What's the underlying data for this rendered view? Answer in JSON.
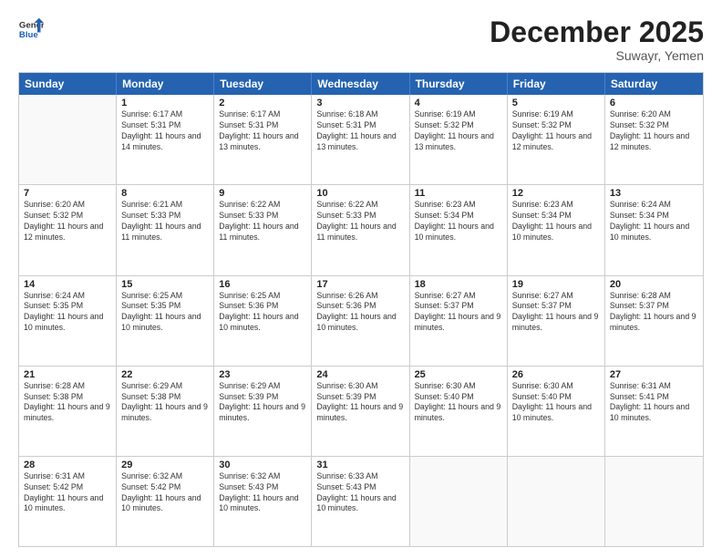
{
  "header": {
    "logo_line1": "General",
    "logo_line2": "Blue",
    "month": "December 2025",
    "location": "Suwayr, Yemen"
  },
  "days_of_week": [
    "Sunday",
    "Monday",
    "Tuesday",
    "Wednesday",
    "Thursday",
    "Friday",
    "Saturday"
  ],
  "weeks": [
    [
      {
        "day": "",
        "sunrise": "",
        "sunset": "",
        "daylight": ""
      },
      {
        "day": "1",
        "sunrise": "Sunrise: 6:17 AM",
        "sunset": "Sunset: 5:31 PM",
        "daylight": "Daylight: 11 hours and 14 minutes."
      },
      {
        "day": "2",
        "sunrise": "Sunrise: 6:17 AM",
        "sunset": "Sunset: 5:31 PM",
        "daylight": "Daylight: 11 hours and 13 minutes."
      },
      {
        "day": "3",
        "sunrise": "Sunrise: 6:18 AM",
        "sunset": "Sunset: 5:31 PM",
        "daylight": "Daylight: 11 hours and 13 minutes."
      },
      {
        "day": "4",
        "sunrise": "Sunrise: 6:19 AM",
        "sunset": "Sunset: 5:32 PM",
        "daylight": "Daylight: 11 hours and 13 minutes."
      },
      {
        "day": "5",
        "sunrise": "Sunrise: 6:19 AM",
        "sunset": "Sunset: 5:32 PM",
        "daylight": "Daylight: 11 hours and 12 minutes."
      },
      {
        "day": "6",
        "sunrise": "Sunrise: 6:20 AM",
        "sunset": "Sunset: 5:32 PM",
        "daylight": "Daylight: 11 hours and 12 minutes."
      }
    ],
    [
      {
        "day": "7",
        "sunrise": "Sunrise: 6:20 AM",
        "sunset": "Sunset: 5:32 PM",
        "daylight": "Daylight: 11 hours and 12 minutes."
      },
      {
        "day": "8",
        "sunrise": "Sunrise: 6:21 AM",
        "sunset": "Sunset: 5:33 PM",
        "daylight": "Daylight: 11 hours and 11 minutes."
      },
      {
        "day": "9",
        "sunrise": "Sunrise: 6:22 AM",
        "sunset": "Sunset: 5:33 PM",
        "daylight": "Daylight: 11 hours and 11 minutes."
      },
      {
        "day": "10",
        "sunrise": "Sunrise: 6:22 AM",
        "sunset": "Sunset: 5:33 PM",
        "daylight": "Daylight: 11 hours and 11 minutes."
      },
      {
        "day": "11",
        "sunrise": "Sunrise: 6:23 AM",
        "sunset": "Sunset: 5:34 PM",
        "daylight": "Daylight: 11 hours and 10 minutes."
      },
      {
        "day": "12",
        "sunrise": "Sunrise: 6:23 AM",
        "sunset": "Sunset: 5:34 PM",
        "daylight": "Daylight: 11 hours and 10 minutes."
      },
      {
        "day": "13",
        "sunrise": "Sunrise: 6:24 AM",
        "sunset": "Sunset: 5:34 PM",
        "daylight": "Daylight: 11 hours and 10 minutes."
      }
    ],
    [
      {
        "day": "14",
        "sunrise": "Sunrise: 6:24 AM",
        "sunset": "Sunset: 5:35 PM",
        "daylight": "Daylight: 11 hours and 10 minutes."
      },
      {
        "day": "15",
        "sunrise": "Sunrise: 6:25 AM",
        "sunset": "Sunset: 5:35 PM",
        "daylight": "Daylight: 11 hours and 10 minutes."
      },
      {
        "day": "16",
        "sunrise": "Sunrise: 6:25 AM",
        "sunset": "Sunset: 5:36 PM",
        "daylight": "Daylight: 11 hours and 10 minutes."
      },
      {
        "day": "17",
        "sunrise": "Sunrise: 6:26 AM",
        "sunset": "Sunset: 5:36 PM",
        "daylight": "Daylight: 11 hours and 10 minutes."
      },
      {
        "day": "18",
        "sunrise": "Sunrise: 6:27 AM",
        "sunset": "Sunset: 5:37 PM",
        "daylight": "Daylight: 11 hours and 9 minutes."
      },
      {
        "day": "19",
        "sunrise": "Sunrise: 6:27 AM",
        "sunset": "Sunset: 5:37 PM",
        "daylight": "Daylight: 11 hours and 9 minutes."
      },
      {
        "day": "20",
        "sunrise": "Sunrise: 6:28 AM",
        "sunset": "Sunset: 5:37 PM",
        "daylight": "Daylight: 11 hours and 9 minutes."
      }
    ],
    [
      {
        "day": "21",
        "sunrise": "Sunrise: 6:28 AM",
        "sunset": "Sunset: 5:38 PM",
        "daylight": "Daylight: 11 hours and 9 minutes."
      },
      {
        "day": "22",
        "sunrise": "Sunrise: 6:29 AM",
        "sunset": "Sunset: 5:38 PM",
        "daylight": "Daylight: 11 hours and 9 minutes."
      },
      {
        "day": "23",
        "sunrise": "Sunrise: 6:29 AM",
        "sunset": "Sunset: 5:39 PM",
        "daylight": "Daylight: 11 hours and 9 minutes."
      },
      {
        "day": "24",
        "sunrise": "Sunrise: 6:30 AM",
        "sunset": "Sunset: 5:39 PM",
        "daylight": "Daylight: 11 hours and 9 minutes."
      },
      {
        "day": "25",
        "sunrise": "Sunrise: 6:30 AM",
        "sunset": "Sunset: 5:40 PM",
        "daylight": "Daylight: 11 hours and 9 minutes."
      },
      {
        "day": "26",
        "sunrise": "Sunrise: 6:30 AM",
        "sunset": "Sunset: 5:40 PM",
        "daylight": "Daylight: 11 hours and 10 minutes."
      },
      {
        "day": "27",
        "sunrise": "Sunrise: 6:31 AM",
        "sunset": "Sunset: 5:41 PM",
        "daylight": "Daylight: 11 hours and 10 minutes."
      }
    ],
    [
      {
        "day": "28",
        "sunrise": "Sunrise: 6:31 AM",
        "sunset": "Sunset: 5:42 PM",
        "daylight": "Daylight: 11 hours and 10 minutes."
      },
      {
        "day": "29",
        "sunrise": "Sunrise: 6:32 AM",
        "sunset": "Sunset: 5:42 PM",
        "daylight": "Daylight: 11 hours and 10 minutes."
      },
      {
        "day": "30",
        "sunrise": "Sunrise: 6:32 AM",
        "sunset": "Sunset: 5:43 PM",
        "daylight": "Daylight: 11 hours and 10 minutes."
      },
      {
        "day": "31",
        "sunrise": "Sunrise: 6:33 AM",
        "sunset": "Sunset: 5:43 PM",
        "daylight": "Daylight: 11 hours and 10 minutes."
      },
      {
        "day": "",
        "sunrise": "",
        "sunset": "",
        "daylight": ""
      },
      {
        "day": "",
        "sunrise": "",
        "sunset": "",
        "daylight": ""
      },
      {
        "day": "",
        "sunrise": "",
        "sunset": "",
        "daylight": ""
      }
    ]
  ]
}
